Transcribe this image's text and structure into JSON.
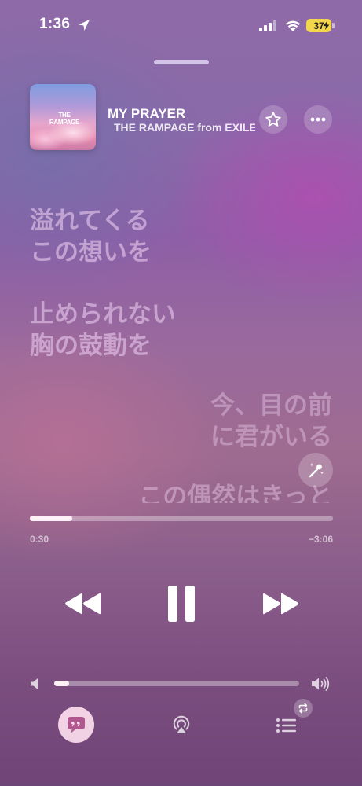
{
  "status_bar": {
    "time": "1:36",
    "battery_level": "37",
    "icons": [
      "location-arrow-icon",
      "cellular-signal-icon",
      "wifi-icon",
      "battery-charging-icon"
    ]
  },
  "now_playing": {
    "title": "MY PRAYER",
    "artist": "THE RAMPAGE from EXILE",
    "album_art_text": "THE RAMPAGE",
    "favorite_icon": "star-icon",
    "more_icon": "ellipsis-icon"
  },
  "lyrics": {
    "lines": [
      "溢れてくる",
      "この想いを",
      "止められない",
      "胸の鼓動を",
      "今、目の前",
      "に君がいる",
      "この偶然はきっと"
    ],
    "sing_icon": "microphone-sparkle-icon"
  },
  "playback": {
    "elapsed": "0:30",
    "remaining": "−3:06",
    "progress": 0.14,
    "controls": [
      "rewind-icon",
      "pause-icon",
      "fast-forward-icon"
    ]
  },
  "volume": {
    "level": 0.06,
    "icons": [
      "speaker-low-icon",
      "speaker-high-icon"
    ]
  },
  "bottom_bar": {
    "icons": [
      "lyrics-quote-bubble-icon",
      "airplay-icon",
      "queue-list-icon",
      "repeat-icon"
    ]
  },
  "colors": {
    "accent_fill": "#fff2f7",
    "battery": "#f3d64a",
    "lyrics_button_bg": "#ffe1f0",
    "lyrics_icon": "#b0578f"
  }
}
